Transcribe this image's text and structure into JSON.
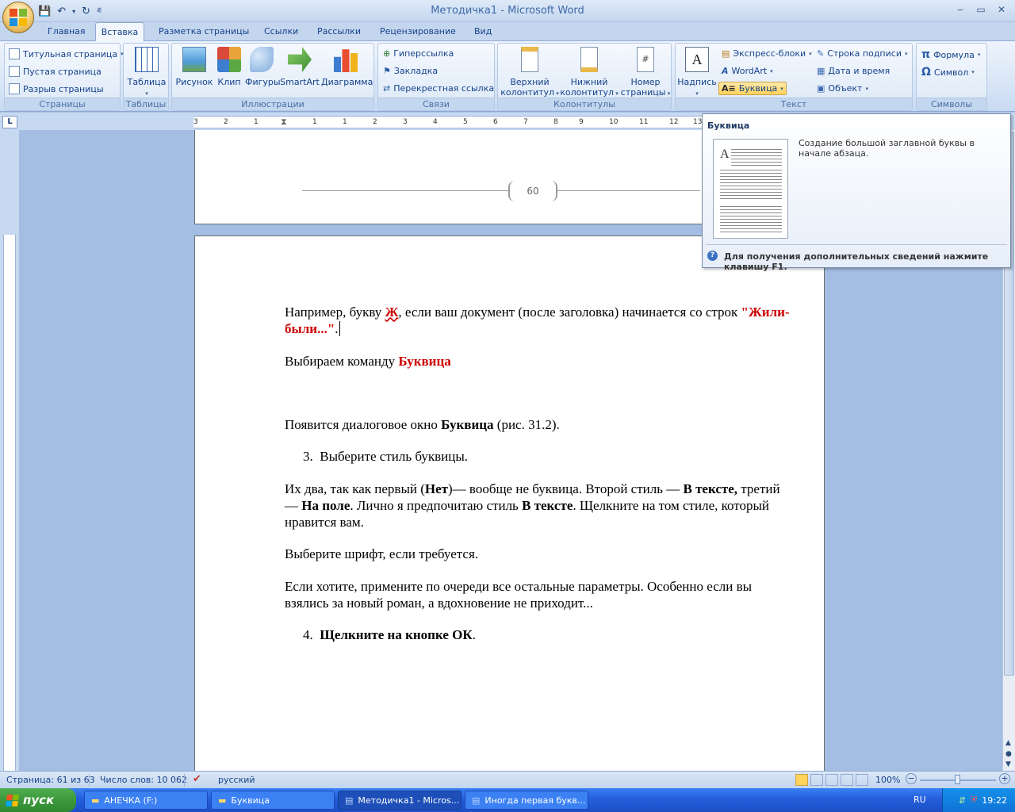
{
  "window": {
    "title": "Методичка1 - Microsoft Word"
  },
  "tabs": [
    "Главная",
    "Вставка",
    "Разметка страницы",
    "Ссылки",
    "Рассылки",
    "Рецензирование",
    "Вид"
  ],
  "ribbon": {
    "pages": {
      "label": "Страницы",
      "title_page": "Титульная страница",
      "blank_page": "Пустая страница",
      "page_break": "Разрыв страницы"
    },
    "tables": {
      "label": "Таблицы",
      "table": "Таблица"
    },
    "illustrations": {
      "label": "Иллюстрации",
      "picture": "Рисунок",
      "clip": "Клип",
      "shapes": "Фигуры",
      "smartart": "SmartArt",
      "chart": "Диаграмма"
    },
    "links": {
      "label": "Связи",
      "hyperlink": "Гиперссылка",
      "bookmark": "Закладка",
      "crossref": "Перекрестная ссылка"
    },
    "headers": {
      "label": "Колонтитулы",
      "header_1": "Верхний",
      "header_2": "колонтитул",
      "footer_1": "Нижний",
      "footer_2": "колонтитул",
      "pagenum_1": "Номер",
      "pagenum_2": "страницы"
    },
    "text": {
      "label": "Текст",
      "textbox": "Надпись",
      "quickparts": "Экспресс-блоки",
      "wordart": "WordArt",
      "dropcap": "Буквица",
      "signature": "Строка подписи",
      "datetime": "Дата и время",
      "object": "Объект"
    },
    "symbols": {
      "label": "Символы",
      "equation": "Формула",
      "symbol": "Символ"
    }
  },
  "ruler": {
    "marks": [
      "3",
      "2",
      "1",
      "1",
      "1",
      "2",
      "3",
      "4",
      "5",
      "6",
      "7",
      "8",
      "9",
      "10",
      "11",
      "12",
      "13"
    ]
  },
  "tooltip": {
    "title": "Буквица",
    "description": "Создание большой заглавной буквы в начале абзаца.",
    "help": "Для получения дополнительных сведений нажмите клавишу F1."
  },
  "document": {
    "page_number": "60",
    "p1_a": "Например, букву ",
    "p1_letter": "Ж",
    "p1_b": ", если ваш документ (после заголовка) начинается со строк ",
    "p1_quote": "\"Жили-были...\"",
    "p1_c": ".",
    "p2_a": "Выбираем  команду ",
    "p2_cmd": "Буквица",
    "p3_a": "Появится диалоговое окно ",
    "p3_b": "Буквица",
    "p3_c": " (рис. 31.2).",
    "item3_num": "3.",
    "item3": "Выберите стиль буквицы.",
    "p4_a": "Их два, так как первый (",
    "p4_b": "Нет",
    "p4_c": ")— вообще не буквица. Второй стиль — ",
    "p4_d": "В тексте,",
    "p4_e": " третий — ",
    "p4_f": "На поле",
    "p4_g": ". Лично я предпочитаю стиль ",
    "p4_h": "В тексте",
    "p4_i": ".  Щелкните на том стиле, который нравится вам.",
    "p5": "Выберите шрифт, если требуется.",
    "p6": "Если хотите, примените по очереди все остальные параметры. Особенно если вы взялись за новый роман, а вдохновение не приходит...",
    "item4_num": "4.",
    "item4": "Щелкните на кнопке ОК",
    "item4_end": "."
  },
  "status": {
    "page": "Страница: 61 из 63",
    "words": "Число слов: 10 062",
    "lang": "русский",
    "zoom": "100%"
  },
  "taskbar": {
    "start": "пуск",
    "tasks": [
      "АНЕЧКА (F:)",
      "Буквица",
      "Методичка1 - Micros...",
      "Иногда первая букв..."
    ],
    "lang": "RU",
    "time": "19:22"
  },
  "colors": {
    "accent_red": "#cc0000",
    "ribbon_text": "#15428b",
    "taskbar_blue": "#245edb",
    "start_green": "#3c983c"
  }
}
